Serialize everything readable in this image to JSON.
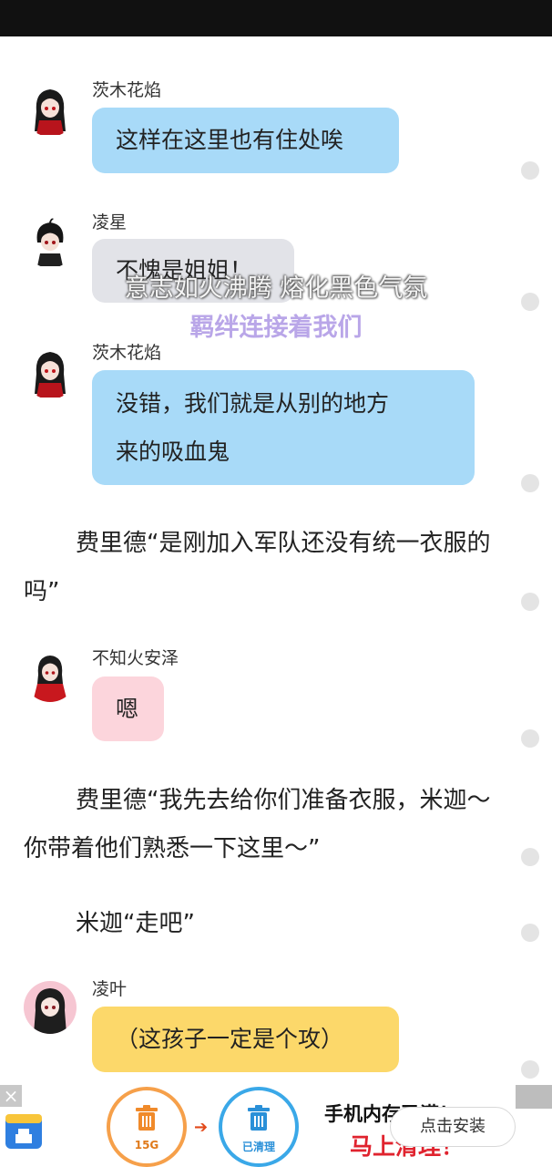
{
  "messages": [
    {
      "sender": "茨木花焰",
      "lines": [
        "这样在这里也有住处唉"
      ],
      "bubble_color": "#a8daf8",
      "avatar": "girl-red-black-hair-avatar"
    },
    {
      "sender": "凌星",
      "lines": [
        "不愧是姐姐！"
      ],
      "bubble_color": "#e2e3e8",
      "avatar": "boy-black-hair-avatar"
    },
    {
      "sender": "茨木花焰",
      "lines": [
        "没错，我们就是从别的地方",
        "来的吸血鬼"
      ],
      "bubble_color": "#a8daf8",
      "avatar": "girl-red-black-hair-avatar"
    },
    {
      "narration": "费里德“是刚加入军队还没有统一衣服的吗”"
    },
    {
      "sender": "不知火安泽",
      "lines": [
        "嗯"
      ],
      "bubble_color": "#fcd5dc",
      "avatar": "girl-black-hair-red-cape-avatar"
    },
    {
      "narration": "费里德“我先去给你们准备衣服，米迦～你带着他们熟悉一下这里～”"
    },
    {
      "narration": "米迦“走吧”"
    },
    {
      "sender": "凌叶",
      "lines": [
        "（这孩子一定是个攻）"
      ],
      "bubble_color": "#fcd86a",
      "avatar": "girl-pink-background-avatar"
    }
  ],
  "lyrics": {
    "line1": "意志如火沸腾 熔化黑色气氛",
    "line2": "羁绊连接着我们"
  },
  "ad": {
    "close_glyph": "×",
    "before_label": "15G",
    "after_label": "已清理",
    "title": "手机内存已满！",
    "subtitle": "马上清理！",
    "install_button": "点击安装",
    "colors": {
      "orange": "#f6a04a",
      "blue": "#3aa8e8",
      "red": "#e0232e"
    }
  }
}
